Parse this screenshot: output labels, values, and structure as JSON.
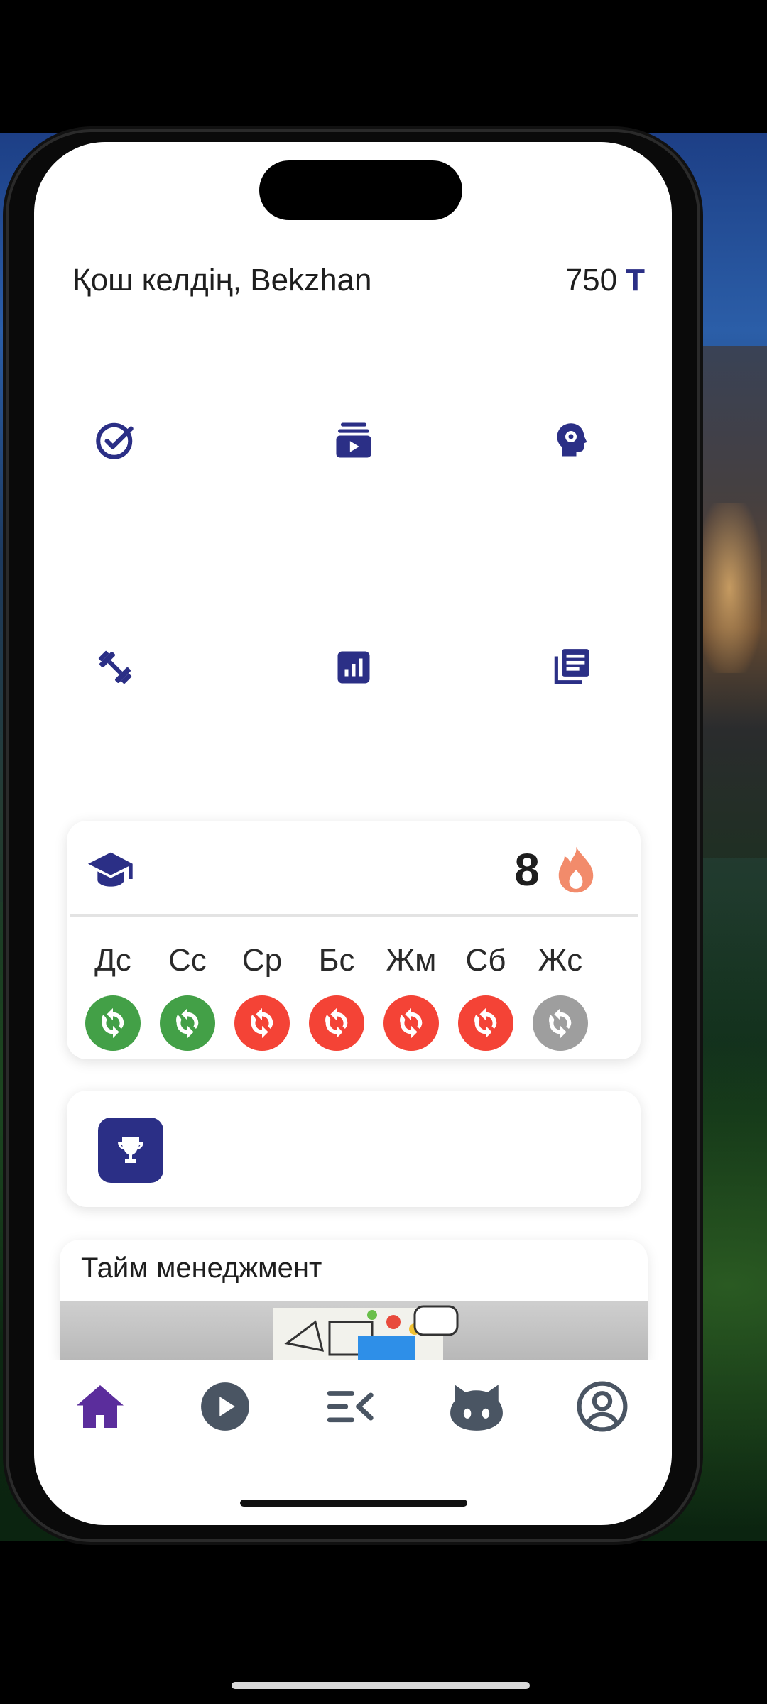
{
  "header": {
    "greeting": "Қош келдің, Bekzhan",
    "coins_value": "750",
    "currency_symbol": "T"
  },
  "quick_actions": [
    {
      "icon": "check-circle-icon"
    },
    {
      "icon": "video-library-icon"
    },
    {
      "icon": "brain-settings-icon"
    },
    {
      "icon": "dumbbell-icon"
    },
    {
      "icon": "bar-chart-icon"
    },
    {
      "icon": "notes-library-icon"
    }
  ],
  "streak": {
    "icon": "graduation-cap-icon",
    "count": "8",
    "fire_icon": "flame-icon",
    "days": [
      {
        "label": "Дс",
        "status": "done"
      },
      {
        "label": "Сс",
        "status": "done"
      },
      {
        "label": "Ср",
        "status": "missed"
      },
      {
        "label": "Бс",
        "status": "missed"
      },
      {
        "label": "Жм",
        "status": "missed"
      },
      {
        "label": "Сб",
        "status": "missed"
      },
      {
        "label": "Жс",
        "status": "pending"
      }
    ]
  },
  "trophy": {
    "icon": "trophy-icon"
  },
  "course": {
    "title": "Тайм менеджмент"
  },
  "bottom_nav": [
    {
      "icon": "home-icon",
      "active": true
    },
    {
      "icon": "play-icon",
      "active": false
    },
    {
      "icon": "playlist-icon",
      "active": false
    },
    {
      "icon": "github-icon",
      "active": false
    },
    {
      "icon": "profile-icon",
      "active": false
    }
  ],
  "colors": {
    "primary": "#2b2f86",
    "active_nav": "#5b2d9c",
    "done": "#43a047",
    "missed": "#f44336",
    "pending": "#9e9e9e",
    "flame": "#f28b6b",
    "nav_gray": "#4a5563"
  }
}
